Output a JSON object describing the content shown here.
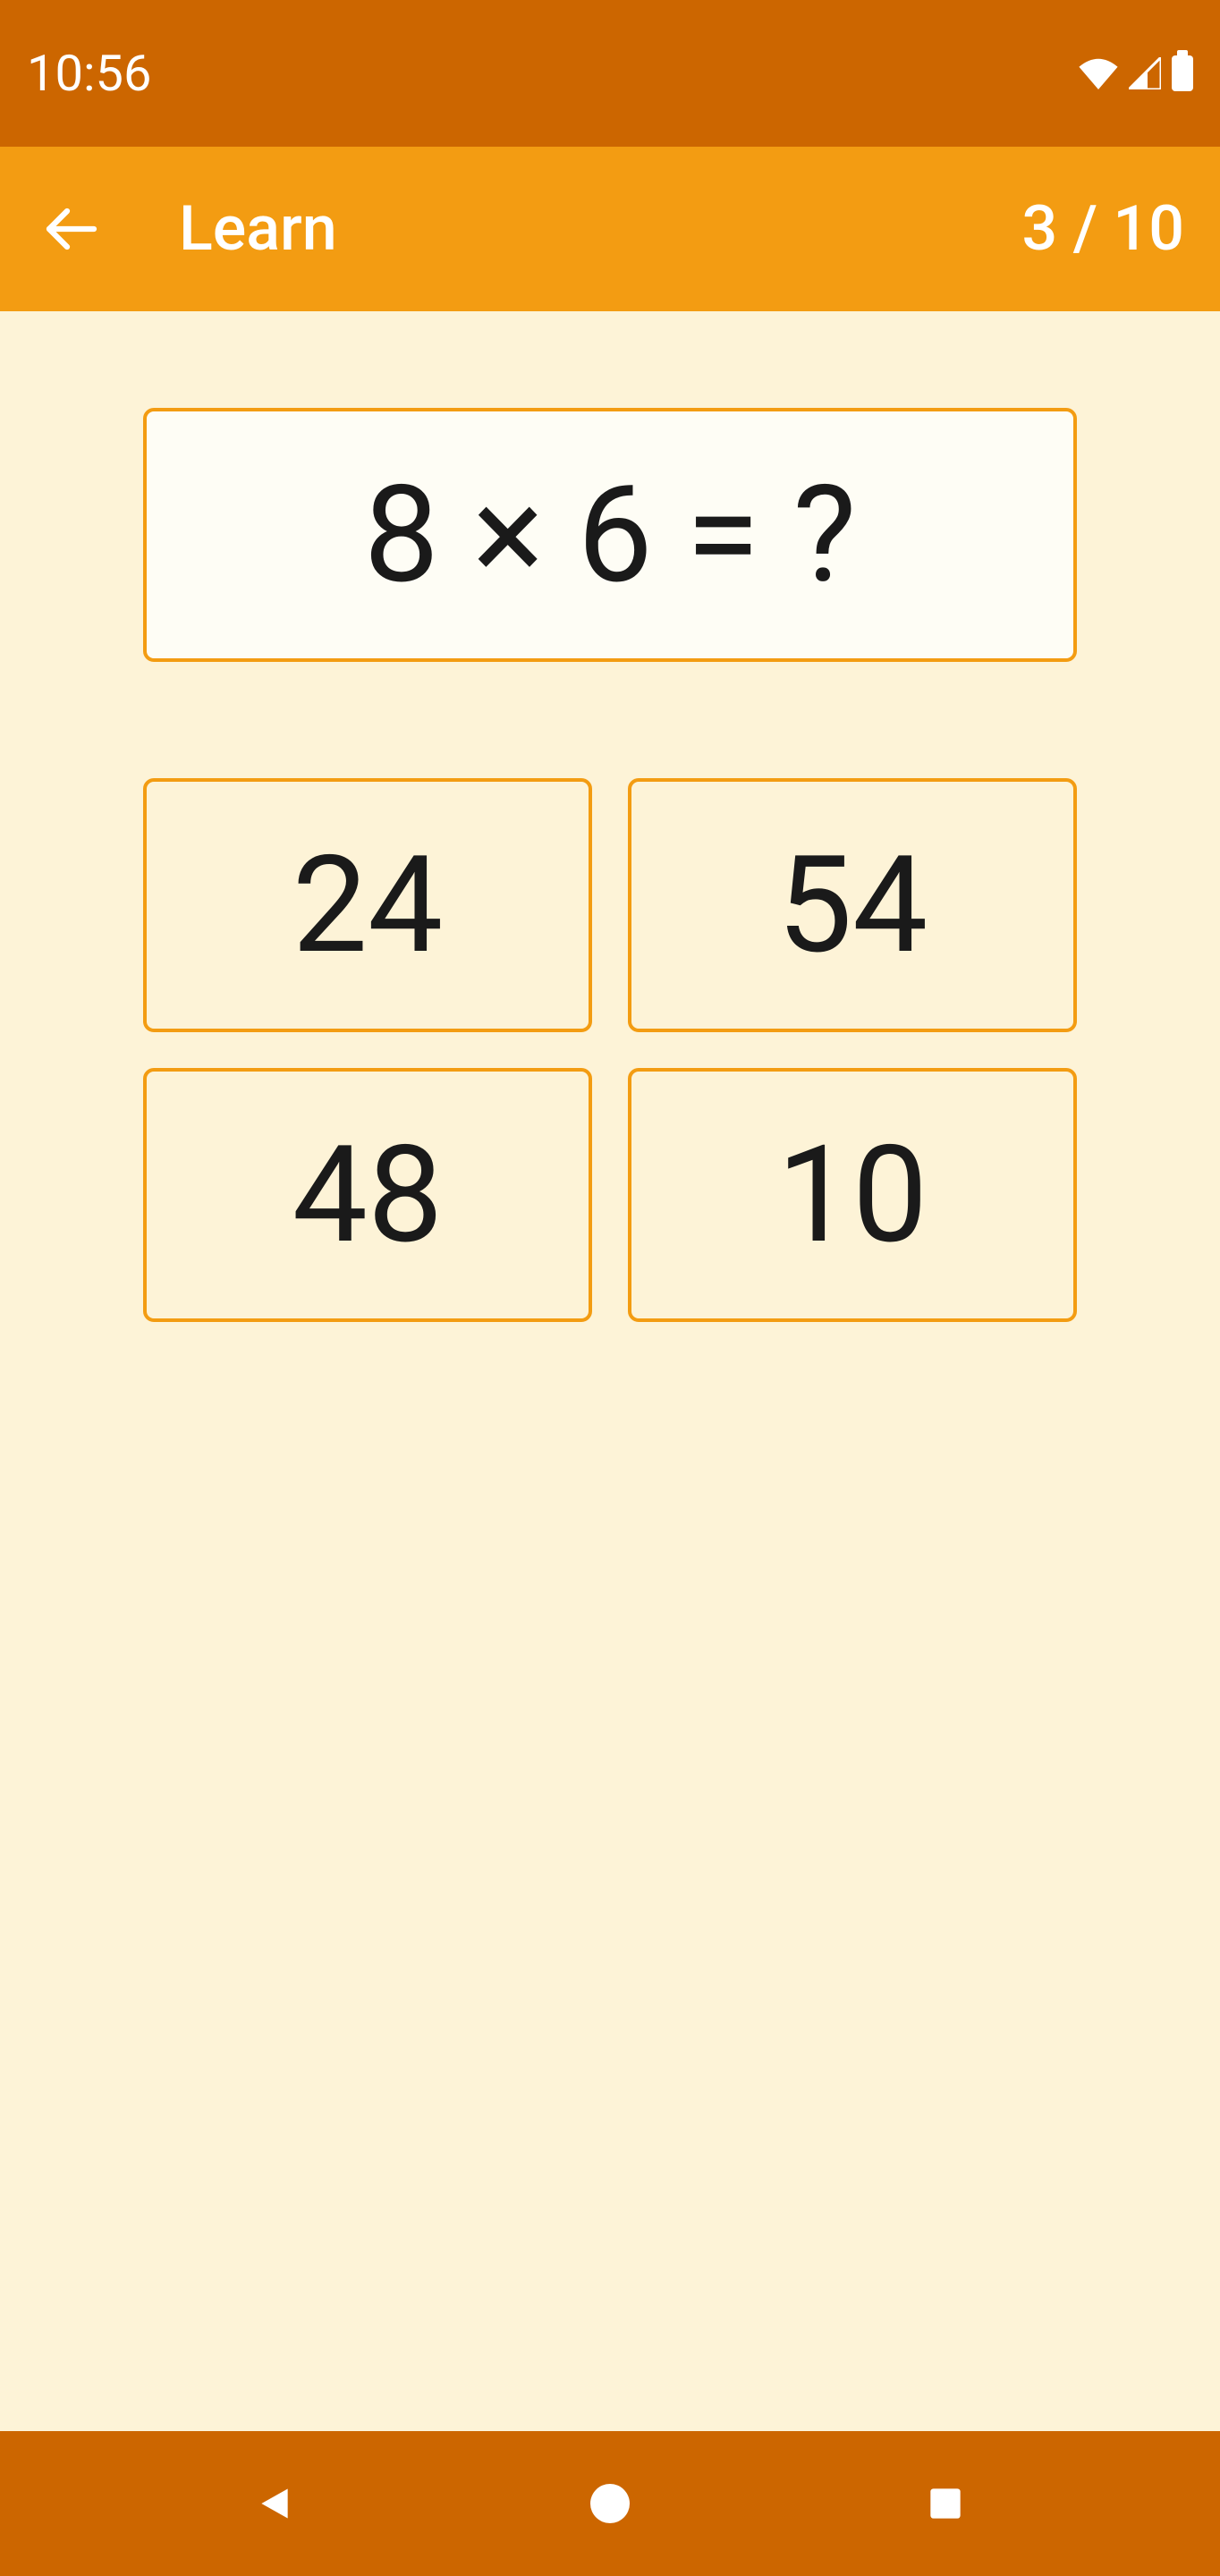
{
  "status": {
    "time": "10:56"
  },
  "header": {
    "title": "Learn",
    "progress": "3 / 10"
  },
  "quiz": {
    "question": "8 × 6 = ?",
    "answers": [
      "24",
      "54",
      "48",
      "10"
    ]
  }
}
